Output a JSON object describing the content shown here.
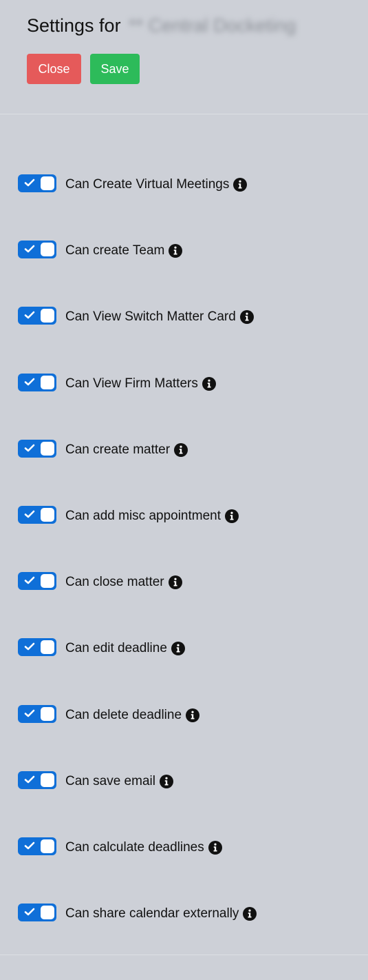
{
  "header": {
    "title_prefix": "Settings for",
    "org_name": "** Central Docketing",
    "close_label": "Close",
    "save_label": "Save"
  },
  "colors": {
    "toggle_on": "#0f6fd8",
    "close_button": "#e55a5a",
    "save_button": "#2dbb5a",
    "background": "#cdd0d7"
  },
  "settings": [
    {
      "label": "Can Create Virtual Meetings",
      "enabled": true,
      "icon": "info-icon"
    },
    {
      "label": "Can create Team",
      "enabled": true,
      "icon": "info-icon"
    },
    {
      "label": "Can View Switch Matter Card",
      "enabled": true,
      "icon": "info-icon"
    },
    {
      "label": "Can View Firm Matters",
      "enabled": true,
      "icon": "info-icon"
    },
    {
      "label": "Can create matter",
      "enabled": true,
      "icon": "info-icon"
    },
    {
      "label": "Can add misc appointment",
      "enabled": true,
      "icon": "info-icon"
    },
    {
      "label": "Can close matter",
      "enabled": true,
      "icon": "info-icon"
    },
    {
      "label": "Can edit deadline",
      "enabled": true,
      "icon": "info-icon"
    },
    {
      "label": "Can delete deadline",
      "enabled": true,
      "icon": "info-icon"
    },
    {
      "label": "Can save email",
      "enabled": true,
      "icon": "info-icon"
    },
    {
      "label": "Can calculate deadlines",
      "enabled": true,
      "icon": "info-icon"
    },
    {
      "label": "Can share calendar externally",
      "enabled": true,
      "icon": "info-icon"
    }
  ]
}
